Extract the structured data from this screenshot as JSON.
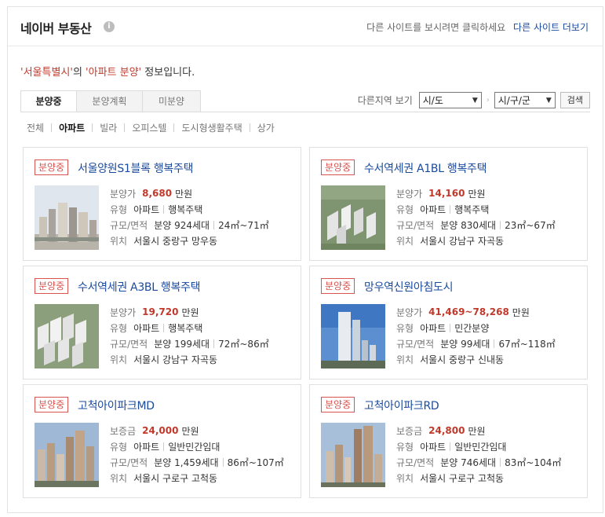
{
  "header": {
    "title": "네이버 부동산",
    "info_icon": "i",
    "right_text": "다른 사이트를 보시려면 클릭하세요",
    "more_link": "다른 사이트 더보기"
  },
  "notice": {
    "region": "'서울특별시'",
    "mid": "의 ",
    "type": "'아파트 분양'",
    "tail": " 정보입니다."
  },
  "tabs": [
    "분양중",
    "분양계획",
    "미분양"
  ],
  "region_select": {
    "label": "다른지역 보기",
    "sido": "시/도",
    "sigungu": "시/구/군",
    "search": "검색"
  },
  "subnav": [
    "전체",
    "아파트",
    "빌라",
    "오피스텔",
    "도시형생활주택",
    "상가"
  ],
  "cards": [
    {
      "badge": "분양중",
      "title": "서울양원S1블록 행복주택",
      "price_label": "분양가",
      "price": "8,680",
      "unit": "만원",
      "type_label": "유형",
      "type1": "아파트",
      "type2": "행복주택",
      "scale_label": "규모/면적",
      "scale1": "분양 924세대",
      "scale2": "24㎡~71㎡",
      "loc_label": "위치",
      "loc": "서울시 중랑구 망우동"
    },
    {
      "badge": "분양중",
      "title": "수서역세권 A1BL 행복주택",
      "price_label": "분양가",
      "price": "14,160",
      "unit": "만원",
      "type_label": "유형",
      "type1": "아파트",
      "type2": "행복주택",
      "scale_label": "규모/면적",
      "scale1": "분양 830세대",
      "scale2": "23㎡~67㎡",
      "loc_label": "위치",
      "loc": "서울시 강남구 자곡동"
    },
    {
      "badge": "분양중",
      "title": "수서역세권 A3BL 행복주택",
      "price_label": "분양가",
      "price": "19,720",
      "unit": "만원",
      "type_label": "유형",
      "type1": "아파트",
      "type2": "행복주택",
      "scale_label": "규모/면적",
      "scale1": "분양 199세대",
      "scale2": "72㎡~86㎡",
      "loc_label": "위치",
      "loc": "서울시 강남구 자곡동"
    },
    {
      "badge": "분양중",
      "title": "망우역신원아침도시",
      "price_label": "분양가",
      "price": "41,469~78,268",
      "unit": "만원",
      "type_label": "유형",
      "type1": "아파트",
      "type2": "민간분양",
      "scale_label": "규모/면적",
      "scale1": "분양 99세대",
      "scale2": "67㎡~118㎡",
      "loc_label": "위치",
      "loc": "서울시 중랑구 신내동"
    },
    {
      "badge": "분양중",
      "title": "고척아이파크MD",
      "price_label": "보증금",
      "price": "24,000",
      "unit": "만원",
      "type_label": "유형",
      "type1": "아파트",
      "type2": "일반민간임대",
      "scale_label": "규모/면적",
      "scale1": "분양 1,459세대",
      "scale2": "86㎡~107㎡",
      "loc_label": "위치",
      "loc": "서울시 구로구 고척동"
    },
    {
      "badge": "분양중",
      "title": "고척아이파크RD",
      "price_label": "보증금",
      "price": "24,800",
      "unit": "만원",
      "type_label": "유형",
      "type1": "아파트",
      "type2": "일반민간임대",
      "scale_label": "규모/면적",
      "scale1": "분양 746세대",
      "scale2": "83㎡~104㎡",
      "loc_label": "위치",
      "loc": "서울시 구로구 고척동"
    }
  ]
}
